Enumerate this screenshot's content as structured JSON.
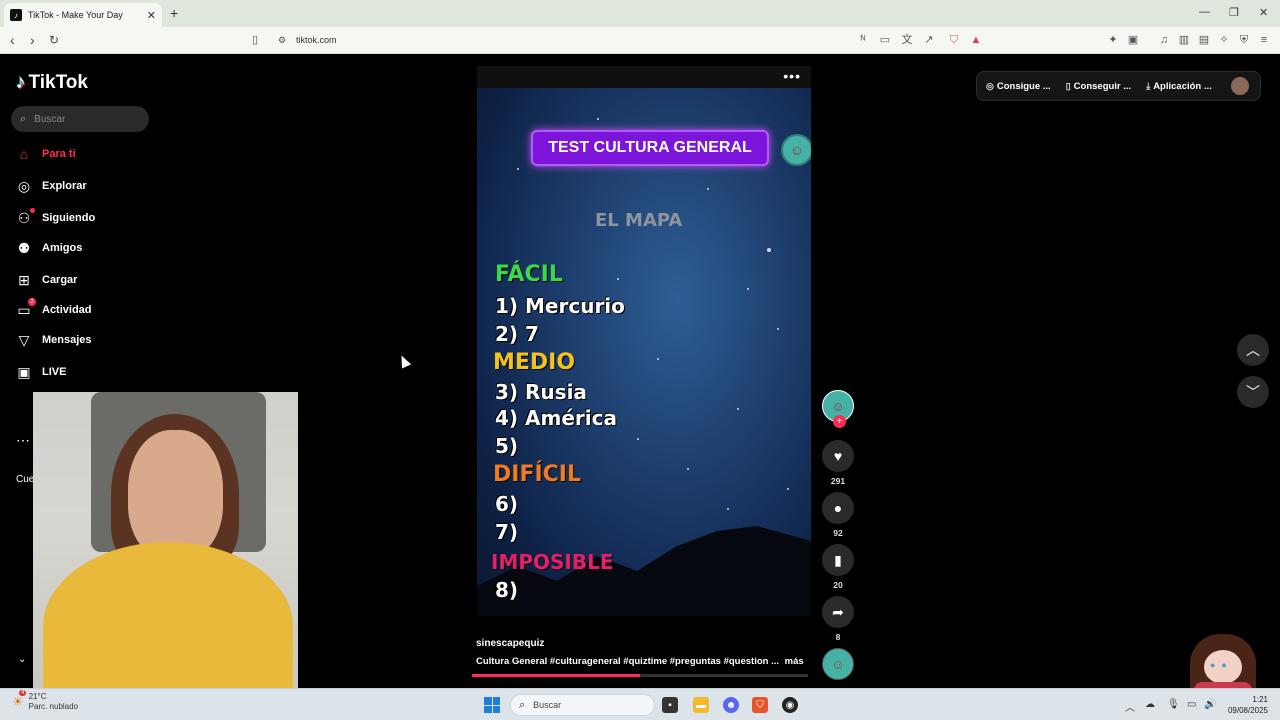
{
  "browser": {
    "tab_title": "TikTok - Make Your Day",
    "url": "tiktok.com"
  },
  "sidebar": {
    "logo": "TikTok",
    "search_placeholder": "Buscar",
    "items": [
      {
        "label": "Para ti",
        "icon": "home-icon",
        "active": true
      },
      {
        "label": "Explorar",
        "icon": "compass-icon"
      },
      {
        "label": "Siguiendo",
        "icon": "following-icon"
      },
      {
        "label": "Amigos",
        "icon": "friends-icon"
      },
      {
        "label": "Cargar",
        "icon": "upload-icon"
      },
      {
        "label": "Actividad",
        "icon": "activity-icon",
        "badge": "2"
      },
      {
        "label": "Mensajes",
        "icon": "send-icon"
      },
      {
        "label": "LIVE",
        "icon": "live-icon"
      }
    ],
    "partial_label": "Cue"
  },
  "topbar": {
    "coins": "Consigue ...",
    "get_app": "Conseguir ...",
    "desktop_app": "Aplicación ..."
  },
  "video": {
    "banner": "TEST CULTURA GENERAL",
    "subtitle": "EL MAPA",
    "levels": {
      "easy": "FÁCIL",
      "medium": "MEDIO",
      "hard": "DIFÍCIL",
      "impossible": "IMPOSIBLE"
    },
    "answers": {
      "a1": "1) Mercurio",
      "a2": "2) 7",
      "a3": "3) Rusia",
      "a4": "4) América",
      "a5": "5)",
      "a6": "6)",
      "a7": "7)",
      "a8": "8)"
    },
    "author": "sinescapequiz",
    "caption": "Cultura General #culturageneral #quiztime #preguntas #question ...",
    "more": "más",
    "progress": 0.5
  },
  "actions": {
    "likes": "291",
    "comments": "92",
    "saves": "20",
    "shares": "8"
  },
  "taskbar": {
    "weather_temp": "21°C",
    "weather_desc": "Parc. nublado",
    "weather_badge": "4",
    "search_placeholder": "Buscar",
    "time": "1:21",
    "date": "09/08/2025"
  },
  "colors": {
    "accent": "#fe2c55",
    "easy": "#3bd84a",
    "medium": "#f4c21c",
    "hard": "#f07a1c",
    "impossible": "#e61f6a",
    "banner": "#7d14d9"
  }
}
